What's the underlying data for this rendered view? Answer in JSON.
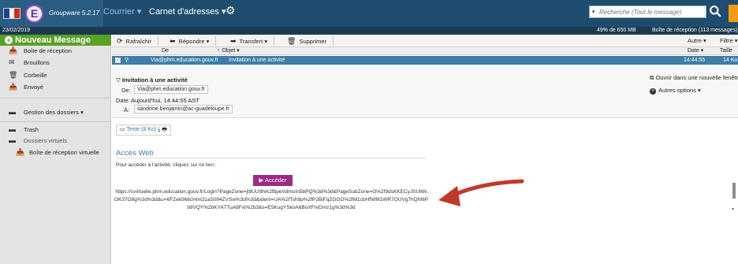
{
  "app": {
    "name": "Groupware 5.2.17",
    "logo_letter": "E"
  },
  "topnav": {
    "courrier": "Courrier ▾",
    "carnet": "Carnet d'adresses ▾",
    "search_placeholder": "Recherche (Tout le message)"
  },
  "status": {
    "date": "23/02/2019",
    "quota": "49% de 650 MB",
    "folder": "Boîte de réception (113 messages)"
  },
  "sidebar": {
    "new_message": "Nouveau Message",
    "items": [
      {
        "label": "Boîte de réception",
        "icon": "inbox-icon"
      },
      {
        "label": "Brouillons",
        "icon": "drafts-icon"
      },
      {
        "label": "Corbeille",
        "icon": "trash-icon"
      },
      {
        "label": "Envoyé",
        "icon": "sent-icon"
      },
      {
        "label": "Gestion des dossiers ▾",
        "icon": "folders-icon"
      },
      {
        "label": "Trash",
        "icon": "folder-icon"
      },
      {
        "label": "Dossiers virtuels",
        "icon": "virtual-folders-icon"
      },
      {
        "label": "Boîte de réception virtuelle",
        "icon": "virtual-inbox-icon"
      }
    ]
  },
  "toolbar": {
    "refresh": "Rafraîchir",
    "reply": "Répondre ▾",
    "forward": "Transfert ▾",
    "delete": "Supprimer",
    "other": "Autre ▾",
    "filter": "Filtre ▾"
  },
  "list_header": {
    "from": "De",
    "subject": "Objet ▾",
    "date": "Date ▾",
    "size": "Taille"
  },
  "message_row": {
    "from": "Via@phm.education.gouv.fr",
    "subject": "Invitation à une activité",
    "time": "14:44:55",
    "size": "14 Ko"
  },
  "message": {
    "subject": "Invitation à une activité",
    "from_label": "De:",
    "from": "Via@phm.education.gouv.fr",
    "date_label": "Date:",
    "date": "Aujourd'hui, 14:44:55 AST",
    "to_label": "À:",
    "to": "sandrine.benjamin@ac-guadeloupe.fr",
    "open_window": "Ouvrir dans une nouvelle fenêtre",
    "other_options": "Autres options ▾",
    "attachment": "Texte (8 Ko)",
    "web_title": "Accès Web",
    "web_text": "Pour accéder à l'activité, cliquez sur ce lien :",
    "access_button": "▶ Accéder",
    "url": "https://cvirtuelle.phm.education.gouv.fr/Login?PageZone=jt9UU9hrk2fbpeVdmuIn5bPQ%3d%3d&PageSubZone=O%2f9dsKKECyJSUWkOK37O8g%3d%3d&u=6FZek966cHmO1aS094ZVSw%3d%3d&ident=UA%2fTsh9p%2fP2BiFqZGGO%2fM1cbHfWM1WR7OUVg7hQht6Pb9VQY%2bKYA7TuA8Fxi%2b3&s=E5KugYSkoA6BoXFrvDmz1g%3d%3d"
  },
  "colors": {
    "topbar": "#1f4d6f",
    "new_message": "#5aa127",
    "selected_row": "#3e7ea7",
    "access_button": "#9b2a88",
    "annotation_arrow": "#c0392b"
  }
}
